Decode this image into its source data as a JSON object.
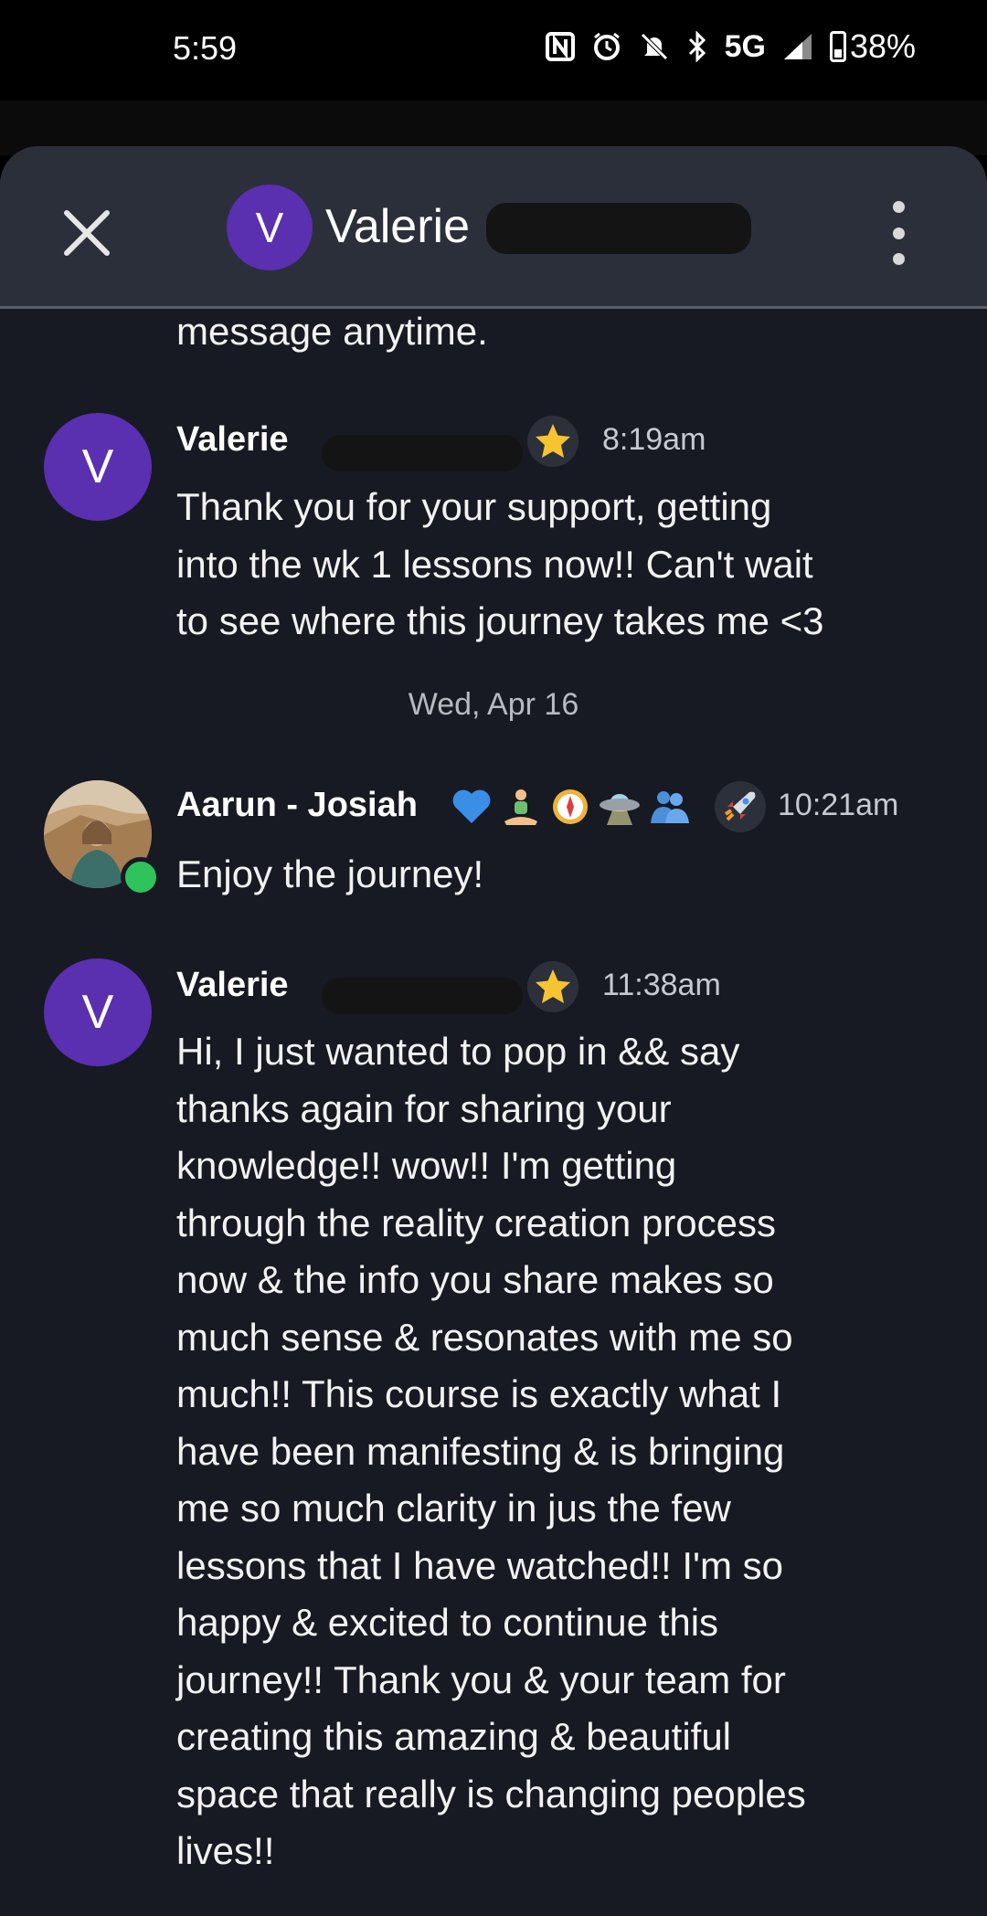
{
  "status_bar": {
    "time": "5:59",
    "network": "5G",
    "battery": "38%",
    "icons": [
      "nfc-icon",
      "alarm-icon",
      "mute-icon",
      "bluetooth-icon",
      "signal-icon",
      "battery-icon"
    ]
  },
  "header": {
    "avatar_initial": "V",
    "contact_name": "Valerie",
    "close_icon": "close-icon",
    "menu_icon": "more-vertical-icon"
  },
  "messages": [
    {
      "text": "message anytime.",
      "partial": true
    },
    {
      "author": "Valerie",
      "avatar_initial": "V",
      "badge": "star-icon",
      "time": "8:19am",
      "text": "Thank you for your support, getting\ninto the wk 1 lessons now!! Can't wait\nto see where this journey takes me <3"
    },
    {
      "author": "Aarun - Josiah",
      "badges": [
        "blue-heart-icon",
        "meditation-icon",
        "compass-icon",
        "ufo-icon",
        "people-icon",
        "rocket-icon"
      ],
      "online": true,
      "time": "10:21am",
      "text": "Enjoy the journey!"
    },
    {
      "author": "Valerie",
      "avatar_initial": "V",
      "badge": "star-icon",
      "time": "11:38am",
      "text": "Hi, I just wanted to pop in && say\nthanks again for sharing your\nknowledge!! wow!! I'm getting\nthrough the reality creation process\nnow & the info you share makes so\nmuch sense & resonates with me so\nmuch!! This course is exactly what I\nhave been manifesting & is bringing\nme so much clarity in jus the few\nlessons that I have watched!! I'm so\nhappy & excited to continue this\njourney!! Thank you & your team for\ncreating this amazing & beautiful\nspace that really is changing peoples\nlives!!"
    }
  ],
  "date_separator": "Wed, Apr 16",
  "colors": {
    "background": "#171a23",
    "header": "#2b2f3a",
    "avatar": "#5a2fb0",
    "online": "#2ec35b",
    "star": "#f6c431"
  }
}
